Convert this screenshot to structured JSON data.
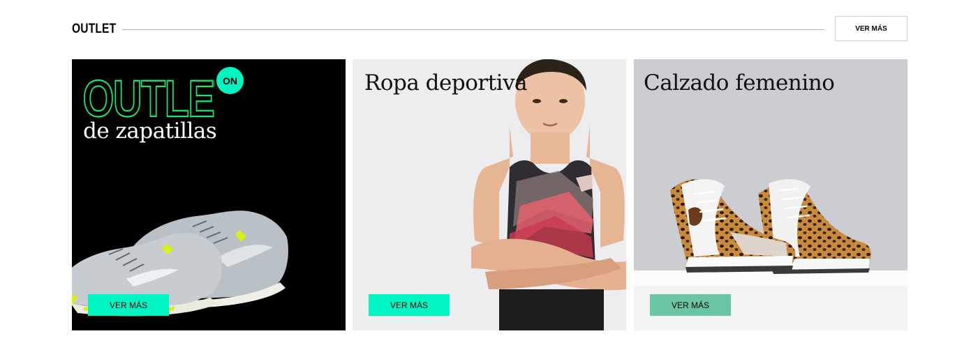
{
  "section": {
    "title": "OUTLET",
    "more_label": "VER MÁS"
  },
  "cards": [
    {
      "headline": "OUTLET",
      "badge": "ON",
      "subtitle": "de zapatillas",
      "cta_label": "VER MÁS",
      "image": "running-sneakers"
    },
    {
      "headline": "Ropa deportiva",
      "cta_label": "VER MÁS",
      "image": "woman-sports-top"
    },
    {
      "headline": "Calzado femenino",
      "cta_label": "VER MÁS",
      "image": "leopard-high-top-sneakers"
    }
  ],
  "colors": {
    "accent": "#00f5c3",
    "accent_muted": "#6ac6a2",
    "outline_neon": "#1ee46f"
  }
}
